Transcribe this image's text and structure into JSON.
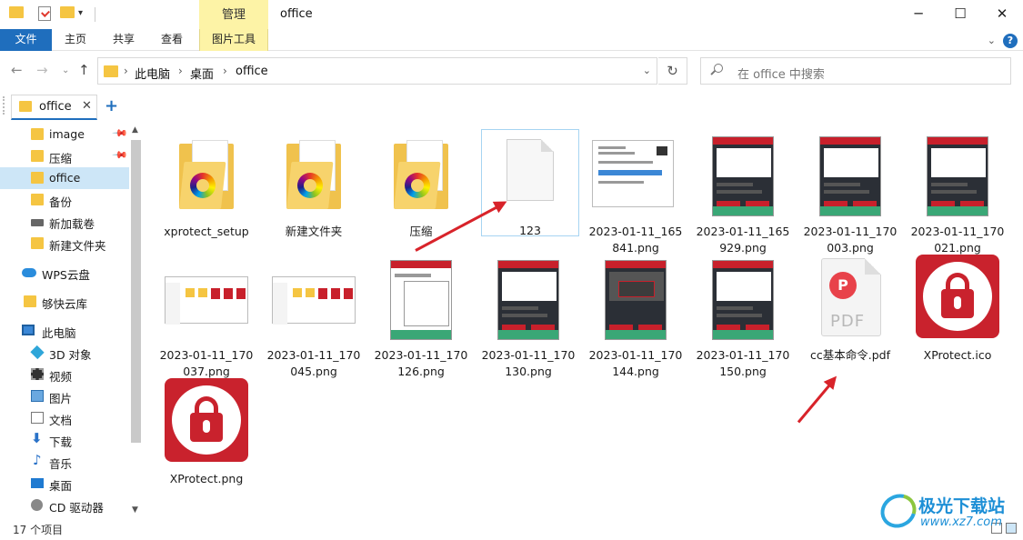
{
  "window": {
    "title": "office",
    "context_tab": "管理",
    "minimize_glyph": "─",
    "maximize_glyph": "☐",
    "close_glyph": "✕"
  },
  "ribbon": {
    "tabs": [
      "文件",
      "主页",
      "共享",
      "查看",
      "图片工具"
    ],
    "collapse_glyph": "⌄",
    "help_glyph": "?"
  },
  "address": {
    "crumbs": [
      "此电脑",
      "桌面",
      "office"
    ],
    "search_placeholder": "在 office 中搜索"
  },
  "folder_tab": {
    "label": "office",
    "close": "✕",
    "add": "+"
  },
  "sidebar": {
    "items": [
      {
        "label": "image",
        "icon": "folder-icon",
        "pinned": true
      },
      {
        "label": "压缩",
        "icon": "folder-icon",
        "pinned": true
      },
      {
        "label": "office",
        "icon": "folder-icon",
        "selected": true
      },
      {
        "label": "备份",
        "icon": "folder-icon"
      },
      {
        "label": "新加载卷",
        "icon": "drive-icon"
      },
      {
        "label": "新建文件夹",
        "icon": "folder-icon"
      },
      {
        "label": "WPS云盘",
        "icon": "cloud-icon"
      },
      {
        "label": "够快云库",
        "icon": "folder-icon"
      },
      {
        "label": "此电脑",
        "icon": "pc-icon"
      },
      {
        "label": "3D 对象",
        "icon": "cube-icon"
      },
      {
        "label": "视频",
        "icon": "video-icon"
      },
      {
        "label": "图片",
        "icon": "picture-icon"
      },
      {
        "label": "文档",
        "icon": "document-icon"
      },
      {
        "label": "下载",
        "icon": "download-icon"
      },
      {
        "label": "音乐",
        "icon": "music-icon"
      },
      {
        "label": "桌面",
        "icon": "desktop-icon"
      },
      {
        "label": "CD 驱动器",
        "icon": "cd-drive-icon"
      }
    ]
  },
  "files": [
    {
      "name": "xprotect_setup",
      "kind": "folder"
    },
    {
      "name": "新建文件夹",
      "kind": "folder"
    },
    {
      "name": "压缩",
      "kind": "folder"
    },
    {
      "name": "123",
      "kind": "blank",
      "selected": true
    },
    {
      "name": "2023-01-11_165841.png",
      "kind": "dialog-shot"
    },
    {
      "name": "2023-01-11_165929.png",
      "kind": "app-shot"
    },
    {
      "name": "2023-01-11_170003.png",
      "kind": "app-shot"
    },
    {
      "name": "2023-01-11_170021.png",
      "kind": "app-shot"
    },
    {
      "name": "2023-01-11_170037.png",
      "kind": "explorer-shot"
    },
    {
      "name": "2023-01-11_170045.png",
      "kind": "explorer-shot"
    },
    {
      "name": "2023-01-11_170126.png",
      "kind": "app-shot"
    },
    {
      "name": "2023-01-11_170130.png",
      "kind": "app-shot"
    },
    {
      "name": "2023-01-11_170144.png",
      "kind": "app-shot"
    },
    {
      "name": "2023-01-11_170150.png",
      "kind": "app-shot"
    },
    {
      "name": "cc基本命令.pdf",
      "kind": "pdf"
    },
    {
      "name": "XProtect.ico",
      "kind": "lock"
    },
    {
      "name": "XProtect.png",
      "kind": "lock"
    }
  ],
  "pdf_logo": "P",
  "pdf_text": "PDF",
  "status": {
    "count": "17 个项目"
  },
  "watermark": {
    "name": "极光下载站",
    "url": "www.xz7.com"
  },
  "colors": {
    "accent": "#1f6ebd",
    "annotation_arrow": "#d8232a",
    "context_tab": "#fdf3a6"
  }
}
